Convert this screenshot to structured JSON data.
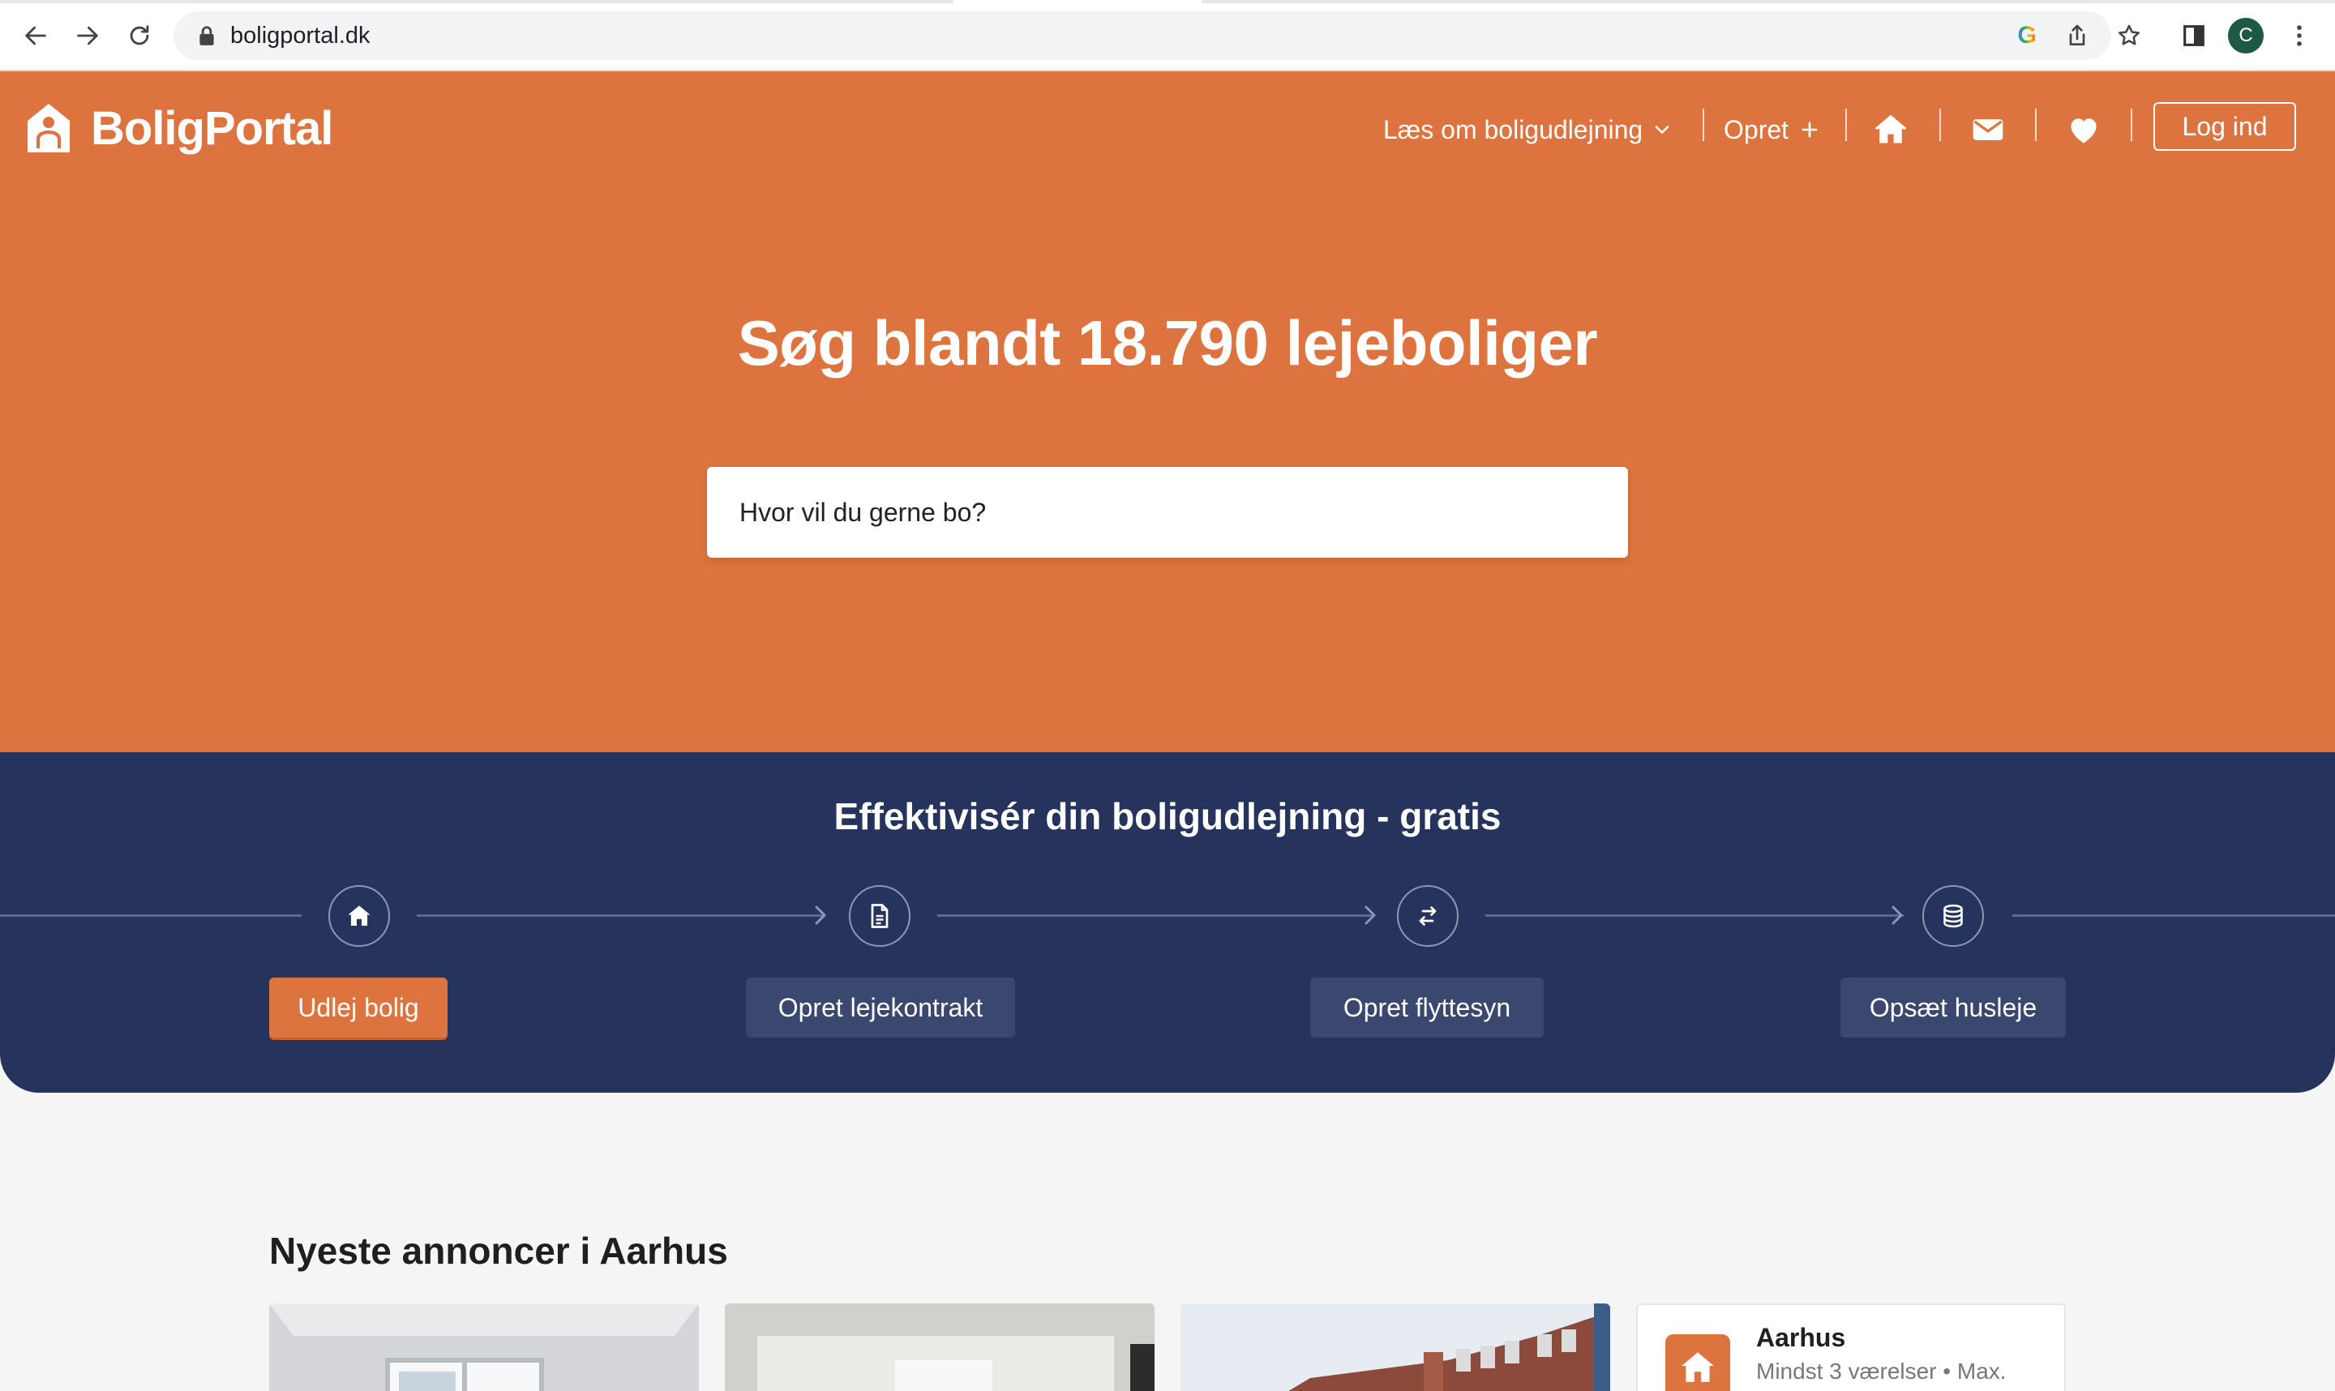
{
  "browser": {
    "url": "boligportal.dk",
    "avatar_letter": "C",
    "google_letter": "G"
  },
  "header": {
    "logo_text": "BoligPortal",
    "nav": {
      "about_label": "Læs om boligudlejning",
      "create_label": "Opret"
    },
    "login_label": "Log ind"
  },
  "hero": {
    "title": "Søg blandt 18.790 lejeboliger",
    "search_placeholder": "Hvor vil du gerne bo?"
  },
  "band": {
    "title": "Effektivisér din boligudlejning - gratis",
    "steps": [
      {
        "label": "Udlej bolig",
        "icon": "house-icon",
        "primary": true
      },
      {
        "label": "Opret lejekontrakt",
        "icon": "document-icon",
        "primary": false
      },
      {
        "label": "Opret flyttesyn",
        "icon": "swap-arrows-icon",
        "primary": false
      },
      {
        "label": "Opsæt husleje",
        "icon": "coins-stack-icon",
        "primary": false
      }
    ]
  },
  "listings": {
    "title": "Nyeste annoncer i Aarhus",
    "agent_card": {
      "title": "Aarhus",
      "subtitle": "Mindst 3 værelser • Max."
    }
  },
  "colors": {
    "brand_orange": "#dd743f",
    "navy": "#26345d",
    "step_button": "#3a4870"
  }
}
